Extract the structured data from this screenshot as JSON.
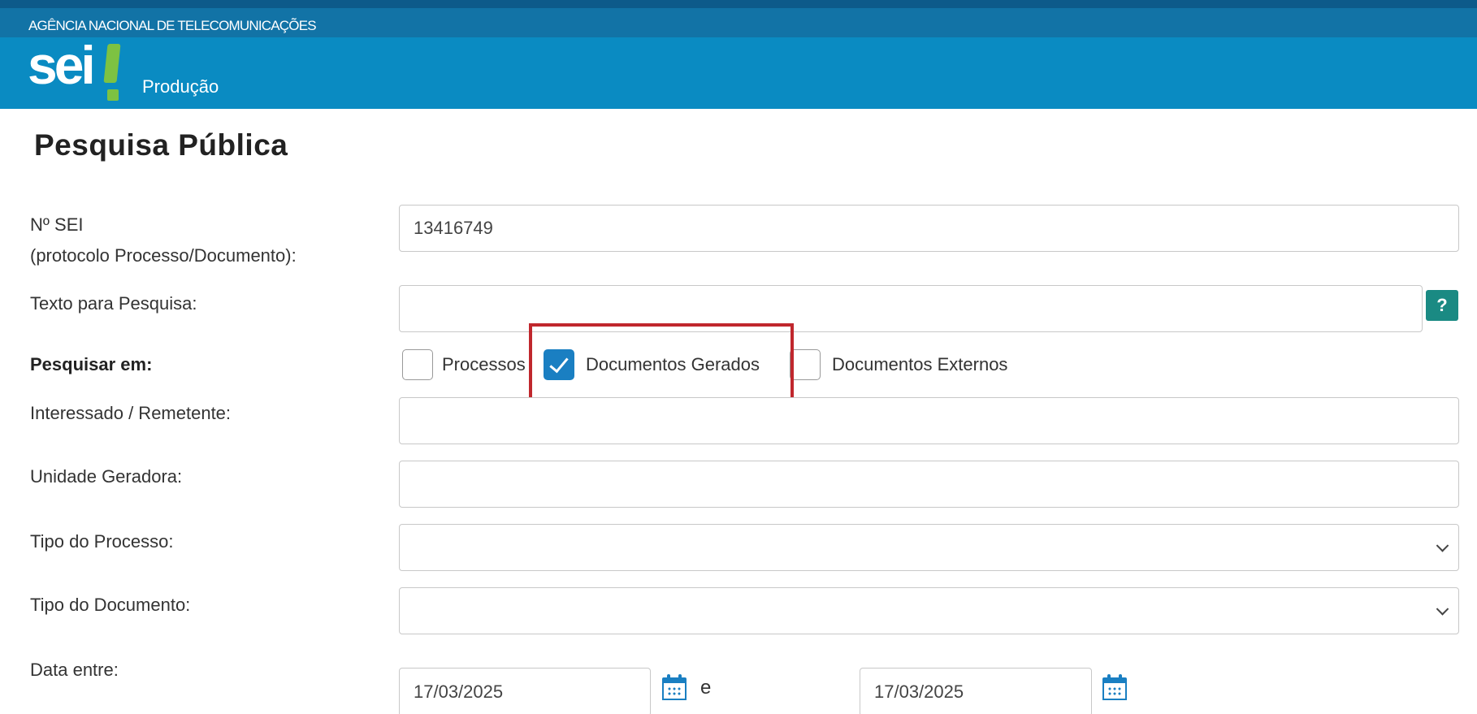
{
  "header": {
    "organization": "AGÊNCIA NACIONAL DE TELECOMUNICAÇÕES",
    "logo_text": "sei",
    "environment": "Produção"
  },
  "page": {
    "title": "Pesquisa Pública"
  },
  "form": {
    "nsei_label_line1": "Nº SEI",
    "nsei_label_line2": "(protocolo Processo/Documento):",
    "nsei_value": "13416749",
    "texto_label": "Texto para Pesquisa:",
    "texto_value": "",
    "help_label": "?",
    "pesquisar_em_label": "Pesquisar em:",
    "options": [
      {
        "label": "Processos",
        "checked": false
      },
      {
        "label": "Documentos Gerados",
        "checked": true
      },
      {
        "label": "Documentos Externos",
        "checked": false
      }
    ],
    "interessado_label": "Interessado / Remetente:",
    "interessado_value": "",
    "unidade_label": "Unidade Geradora:",
    "unidade_value": "",
    "tipo_processo_label": "Tipo do Processo:",
    "tipo_processo_value": "",
    "tipo_documento_label": "Tipo do Documento:",
    "tipo_documento_value": "",
    "data_label": "Data entre:",
    "data_inicio": "17/03/2025",
    "data_separator": "e",
    "data_fim": "17/03/2025"
  },
  "colors": {
    "header_dark": "#1273a6",
    "header_light": "#0a8bc2",
    "logo_accent": "#7dc242",
    "checkbox_checked": "#1a7fc2",
    "help_button": "#1a8a83",
    "highlight_box": "#c0272d"
  },
  "icons": [
    "calendar-icon",
    "chevron-down-icon",
    "checkmark-icon",
    "help-icon"
  ]
}
